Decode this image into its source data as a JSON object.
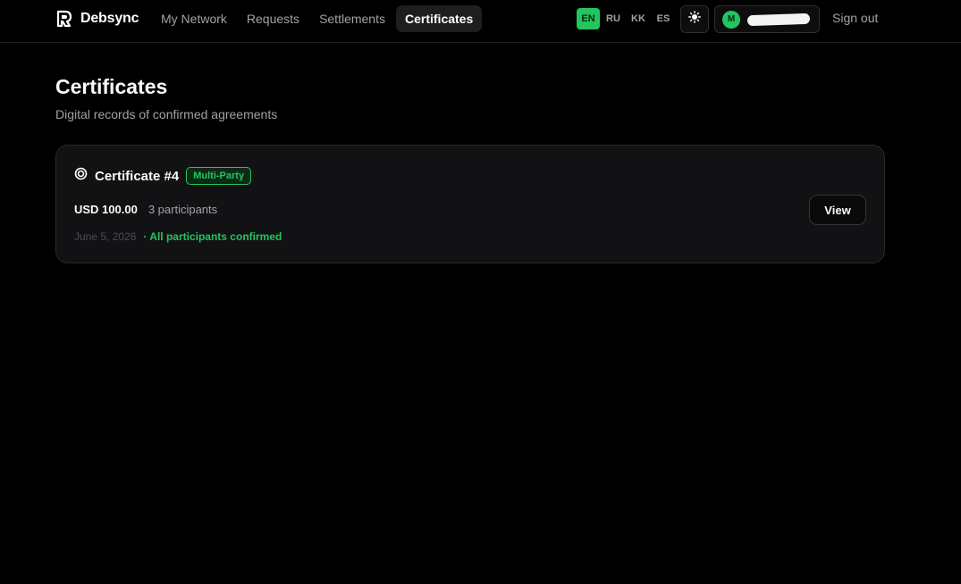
{
  "brand": {
    "name": "Debsync",
    "logo_icon": "debsync-logo-icon"
  },
  "nav": {
    "items": [
      {
        "label": "My Network",
        "active": false
      },
      {
        "label": "Requests",
        "active": false
      },
      {
        "label": "Settlements",
        "active": false
      },
      {
        "label": "Certificates",
        "active": true
      }
    ]
  },
  "languages": {
    "items": [
      {
        "code": "EN",
        "active": true
      },
      {
        "code": "RU",
        "active": false
      },
      {
        "code": "KK",
        "active": false
      },
      {
        "code": "ES",
        "active": false
      }
    ]
  },
  "theme_toggle": {
    "icon": "sun-icon"
  },
  "user": {
    "avatar_initial": "M"
  },
  "signout_label": "Sign out",
  "page": {
    "title": "Certificates",
    "subtitle": "Digital records of confirmed agreements"
  },
  "certificates": [
    {
      "title": "Certificate #4",
      "icon": "certificate-icon",
      "badge": "Multi-Party",
      "amount": "USD 100.00",
      "participants": "3 participants",
      "date": "June 5, 2026",
      "status": "· All participants confirmed",
      "action_label": "View"
    }
  ],
  "colors": {
    "accent": "#22c55e",
    "background": "#000000",
    "card": "#121214",
    "muted_text": "#a1a1aa"
  }
}
